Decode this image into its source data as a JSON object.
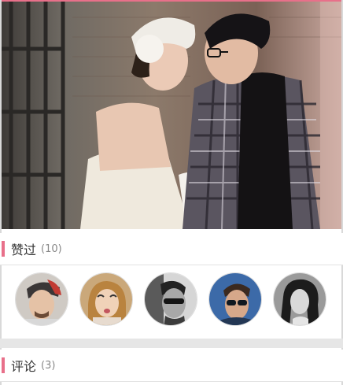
{
  "likes": {
    "title": "赞过",
    "count": "(10)"
  },
  "comments": {
    "title": "评论",
    "count": "(3)"
  },
  "avatars": [
    {
      "name": "avatar-user-1"
    },
    {
      "name": "avatar-user-2"
    },
    {
      "name": "avatar-user-3"
    },
    {
      "name": "avatar-user-4"
    },
    {
      "name": "avatar-user-5"
    }
  ],
  "colors": {
    "accent": "#e8708a",
    "divider": "#e2e2e2"
  }
}
